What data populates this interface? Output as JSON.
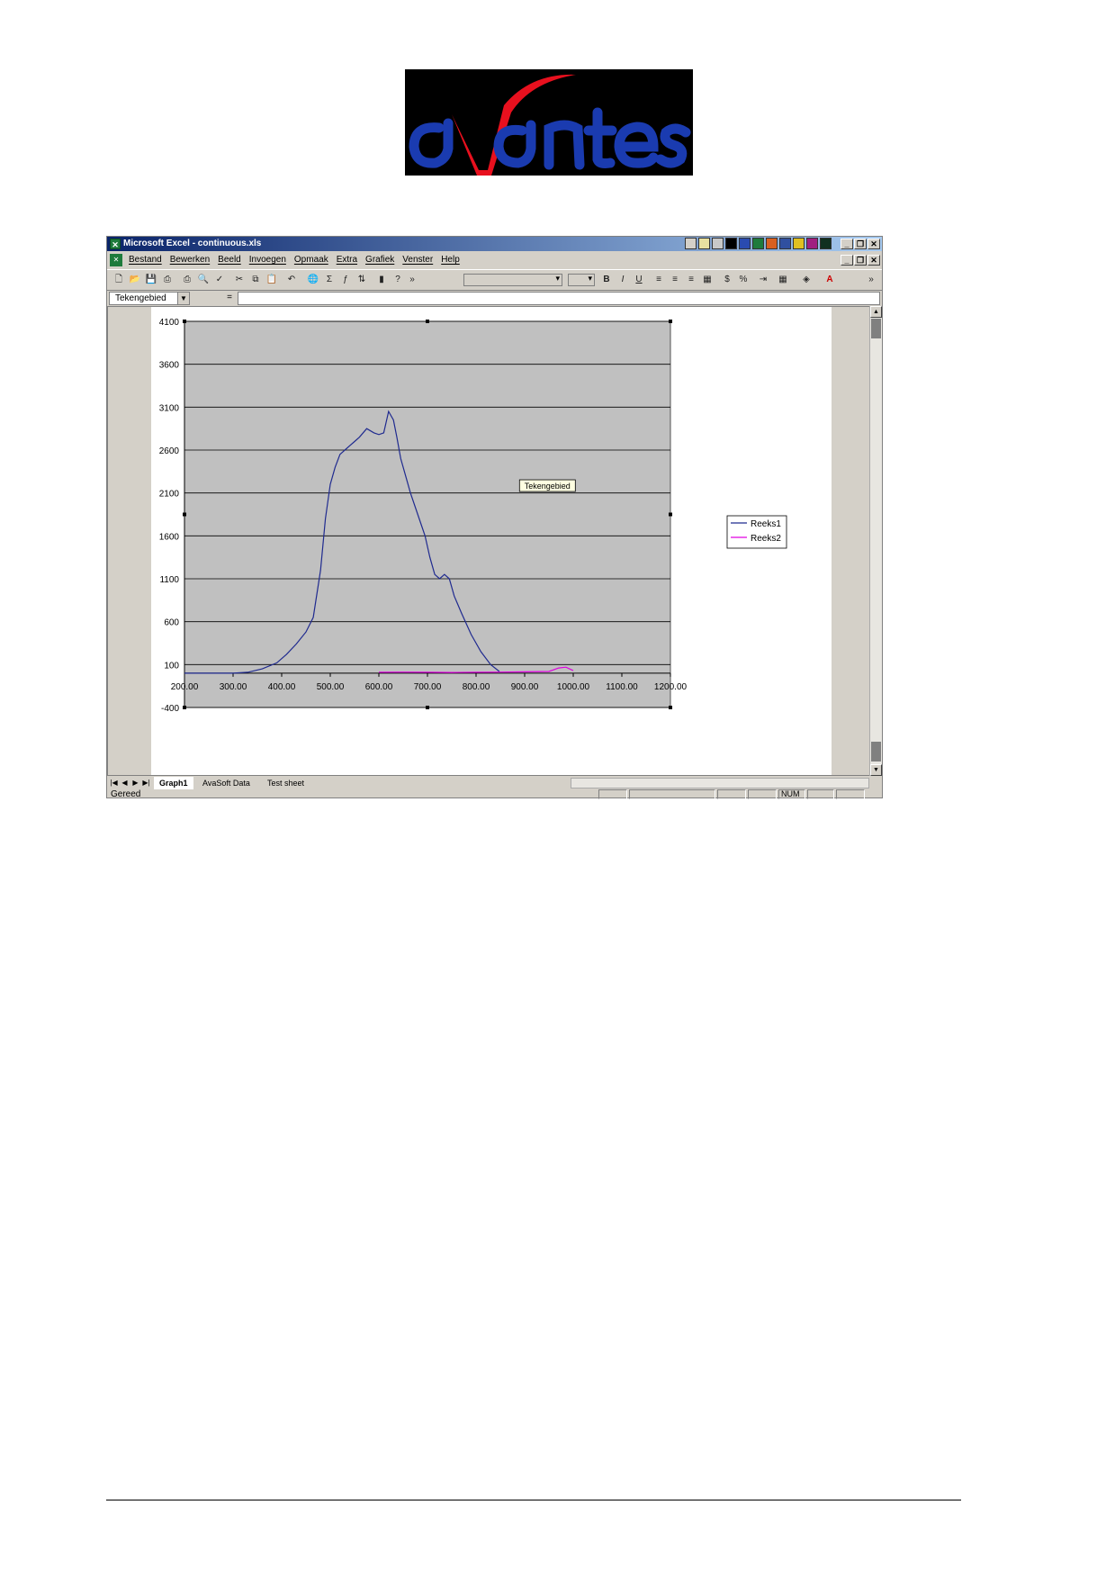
{
  "window": {
    "title": "Microsoft Excel - continuous.xls"
  },
  "menu": [
    "Bestand",
    "Bewerken",
    "Beeld",
    "Invoegen",
    "Opmaak",
    "Extra",
    "Grafiek",
    "Venster",
    "Help"
  ],
  "formula_bar": {
    "name_box": "Tekengebied",
    "equals": "="
  },
  "tooltip": "Tekengebied",
  "sheet_tabs": [
    "Graph1",
    "AvaSoft Data",
    "Test sheet"
  ],
  "status": {
    "text": "Gereed",
    "num": "NUM"
  },
  "colors": {
    "title_bar": "#0a246a",
    "plot_area": "#c0c0c0",
    "series1": "#1f2a8f",
    "series2": "#e000e0",
    "logo_red": "#e8101e",
    "logo_blue": "#1a3bb0"
  },
  "chart_data": {
    "type": "scatter",
    "title": "",
    "xlabel": "",
    "ylabel": "",
    "xlim": [
      200,
      1200
    ],
    "ylim": [
      -400,
      4100
    ],
    "x_ticks": [
      "200.00",
      "300.00",
      "400.00",
      "500.00",
      "600.00",
      "700.00",
      "800.00",
      "900.00",
      "1000.00",
      "1100.00",
      "1200.00"
    ],
    "y_ticks": [
      "4100",
      "3600",
      "3100",
      "2600",
      "2100",
      "1600",
      "1100",
      "600",
      "100",
      "-400"
    ],
    "legend": "right",
    "grid": "horizontal",
    "series": [
      {
        "name": "Reeks1",
        "x": [
          200,
          250,
          300,
          330,
          360,
          390,
          410,
          430,
          450,
          465,
          480,
          490,
          500,
          510,
          520,
          530,
          540,
          550,
          560,
          575,
          590,
          600,
          610,
          620,
          630,
          637,
          645,
          655,
          665,
          680,
          695,
          705,
          715,
          725,
          735,
          745,
          755,
          770,
          790,
          810,
          830,
          848
        ],
        "y": [
          0,
          0,
          0,
          10,
          50,
          120,
          220,
          340,
          480,
          650,
          1200,
          1800,
          2200,
          2400,
          2550,
          2600,
          2650,
          2700,
          2750,
          2850,
          2800,
          2780,
          2800,
          3050,
          2950,
          2750,
          2500,
          2300,
          2100,
          1850,
          1600,
          1350,
          1150,
          1100,
          1150,
          1100,
          900,
          700,
          450,
          250,
          100,
          20
        ]
      },
      {
        "name": "Reeks2",
        "x": [
          600,
          650,
          700,
          750,
          800,
          850,
          900,
          950,
          970,
          985,
          1000
        ],
        "y": [
          10,
          12,
          10,
          8,
          10,
          12,
          15,
          20,
          60,
          70,
          30
        ]
      }
    ]
  }
}
